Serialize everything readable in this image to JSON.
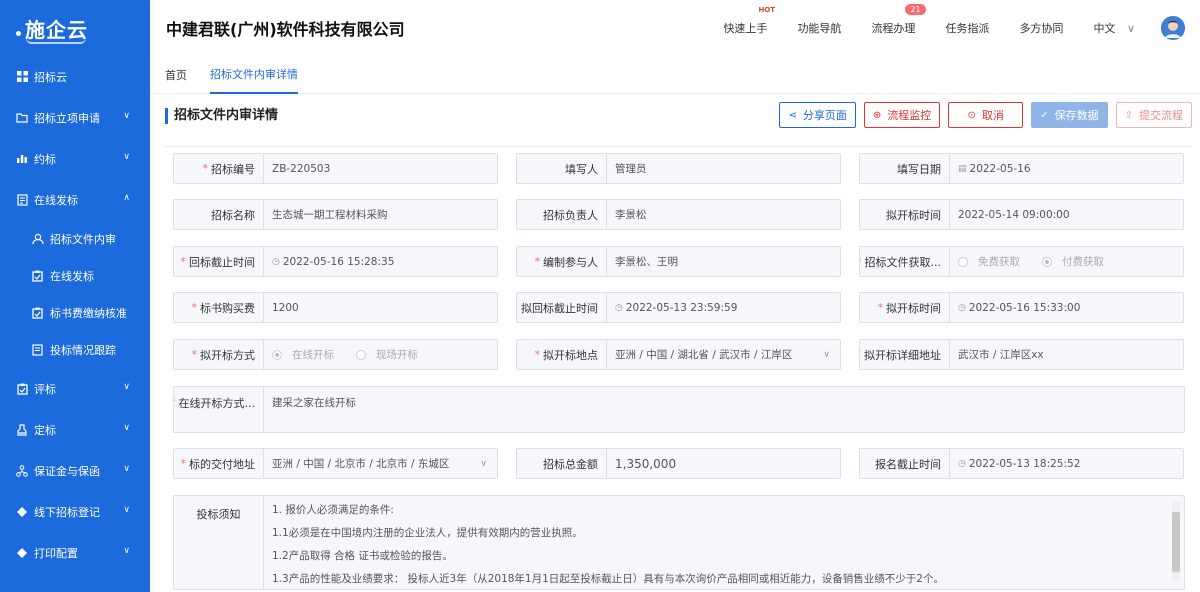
{
  "brand": {
    "logo_text": "施企云"
  },
  "sidebar": {
    "items": [
      {
        "label": "招标云",
        "icon": "grid-icon",
        "chevron": ""
      },
      {
        "label": "招标立项申请",
        "icon": "folder-icon",
        "chevron": "∨"
      },
      {
        "label": "约标",
        "icon": "chart-icon",
        "chevron": "∨"
      },
      {
        "label": "在线发标",
        "icon": "document-icon",
        "chevron": "∧"
      }
    ],
    "subitems": [
      {
        "label": "招标文件内审",
        "icon": "user-icon"
      },
      {
        "label": "在线发标",
        "icon": "clipboard-icon"
      },
      {
        "label": "标书费缴纳核准",
        "icon": "clipboard-check-icon"
      },
      {
        "label": "投标情况跟踪",
        "icon": "document-icon"
      }
    ],
    "items2": [
      {
        "label": "评标",
        "icon": "clipboard-icon",
        "chevron": "∨"
      },
      {
        "label": "定标",
        "icon": "stamp-icon",
        "chevron": "∨"
      },
      {
        "label": "保证金与保函",
        "icon": "network-icon",
        "chevron": "∨"
      },
      {
        "label": "线下招标登记",
        "icon": "diamond-icon",
        "chevron": "∨"
      },
      {
        "label": "打印配置",
        "icon": "printer-icon",
        "chevron": "∨"
      }
    ]
  },
  "header": {
    "company": "中建君联(广州)软件科技有限公司",
    "menu": [
      "快速上手",
      "功能导航",
      "流程办理",
      "任务指派",
      "多方协同"
    ],
    "hot_label": "HOT",
    "badge_count": "21",
    "language": "中文"
  },
  "tabs": [
    "首页",
    "招标文件内审详情"
  ],
  "page": {
    "title": "招标文件内审详情",
    "actions": {
      "share": "分享页面",
      "monitor": "流程监控",
      "cancel": "取消",
      "save": "保存数据",
      "submit": "提交流程"
    }
  },
  "form": {
    "bid_no": {
      "label": "招标编号",
      "value": "ZB-220503"
    },
    "filler": {
      "label": "填写人",
      "value": "管理员"
    },
    "fill_date": {
      "label": "填写日期",
      "value": "2022-05-16"
    },
    "bid_name": {
      "label": "招标名称",
      "value": "生态城一期工程材料采购"
    },
    "bid_owner": {
      "label": "招标负责人",
      "value": "李景松"
    },
    "planned_open": {
      "label": "拟开标时间",
      "value": "2022-05-14 09:00:00"
    },
    "reply_deadline": {
      "label": "回标截止时间",
      "value": "2022-05-16 15:28:35"
    },
    "editors": {
      "label": "编制参与人",
      "value": "李景松、王明"
    },
    "doc_obtain": {
      "label": "招标文件获取...",
      "opt1": "免费获取",
      "opt2": "付费获取"
    },
    "doc_fee": {
      "label": "标书购买费",
      "value": "1200"
    },
    "planned_reply_deadline": {
      "label": "拟回标截止时间",
      "value": "2022-05-13 23:59:59"
    },
    "planned_open2": {
      "label": "拟开标时间",
      "value": "2022-05-16 15:33:00"
    },
    "open_method": {
      "label": "拟开标方式",
      "opt1": "在线开标",
      "opt2": "现场开标"
    },
    "open_place": {
      "label": "拟开标地点",
      "value": "亚洲 / 中国 / 湖北省 / 武汉市 / 江岸区"
    },
    "open_address": {
      "label": "拟开标详细地址",
      "value": "武汉市 / 江岸区xx"
    },
    "online_method": {
      "label": "在线开标方式...",
      "value": "建采之家在线开标"
    },
    "delivery_address": {
      "label": "标的交付地址",
      "value": "亚洲 / 中国 / 北京市 / 北京市 / 东城区"
    },
    "total_amount": {
      "label": "招标总金额",
      "value": "1,350,000"
    },
    "signup_deadline": {
      "label": "报名截止时间",
      "value": "2022-05-13 18:25:52"
    },
    "notes": {
      "label": "投标须知",
      "lines": [
        "1. 报价人必须满足的条件:",
        "1.1必须是在中国境内注册的企业法人，提供有效期内的营业执照。",
        "1.2产品取得 合格  证书或检验的报告。",
        "1.3产品的性能及业绩要求：  投标人近3年（从2018年1月1日起至投标截止日）具有与本次询价产品相同或相近能力，设备销售业绩不少于2个。"
      ]
    }
  }
}
